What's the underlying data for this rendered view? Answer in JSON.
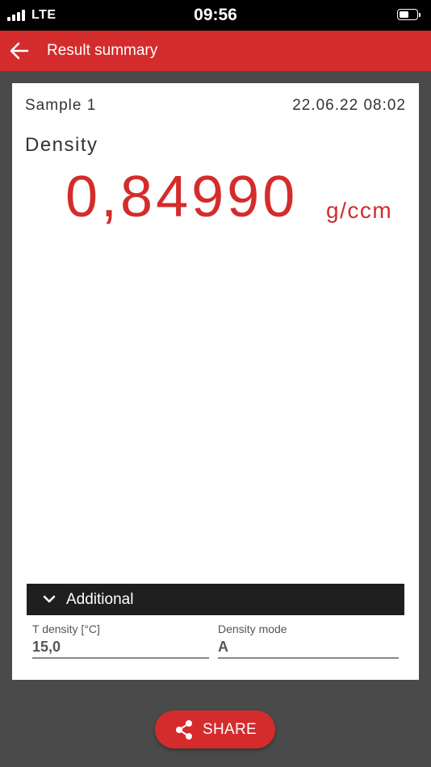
{
  "status_bar": {
    "network": "LTE",
    "time": "09:56"
  },
  "app_bar": {
    "title": "Result summary",
    "back_icon": "arrow-left-icon"
  },
  "result": {
    "sample_name": "Sample 1",
    "timestamp": "22.06.22 08:02",
    "measurement_label": "Density",
    "value": "0,84990",
    "unit": "g/ccm"
  },
  "additional": {
    "label": "Additional",
    "expand_icon": "chevron-down-icon",
    "fields": [
      {
        "label": "T density [°C]",
        "value": "15,0"
      },
      {
        "label": "Density mode",
        "value": "A"
      }
    ]
  },
  "share_button": {
    "label": "SHARE",
    "icon": "share-icon"
  },
  "colors": {
    "accent": "#d42c2c",
    "background": "#4a4a4a",
    "card": "#ffffff",
    "section_header": "#1f1f1f"
  }
}
